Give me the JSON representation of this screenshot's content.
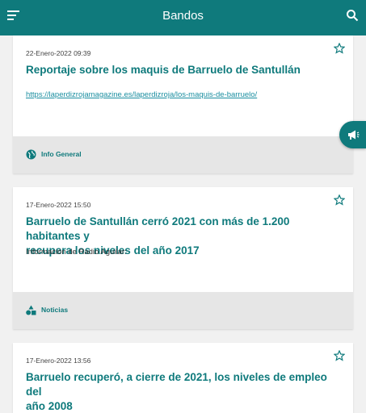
{
  "appbar": {
    "title": "Bandos",
    "menu_icon": "menu-icon",
    "search_icon": "search-icon"
  },
  "colors": {
    "primary": "#0f7a7c",
    "background": "#f1f1f1",
    "footer": "#e6e6e6"
  },
  "posts": [
    {
      "date": "22-Enero-2022 09:39",
      "title": "Reportaje sobre los maquis de Barruelo de Santullán",
      "link": "https://laperdizrojamagazine.es/laperdizroja/los-maquis-de-barruelo/",
      "category": "Info General",
      "category_icon": "globe-icon"
    },
    {
      "date": "17-Enero-2022 15:50",
      "title_line1": "Barruelo de Santullán cerró 2021 con más de 1.200 habitantes y",
      "title_line2": "recupera los niveles del año 2017",
      "body": "Información de Radio Aguilar:",
      "category": "Noticias",
      "category_icon": "shapes-icon"
    },
    {
      "date": "17-Enero-2022 13:56",
      "title_line1": "Barruelo recuperó, a cierre de 2021, los niveles de empleo del",
      "title_line2": "año 2008"
    }
  ],
  "fab_icon": "megaphone-icon"
}
